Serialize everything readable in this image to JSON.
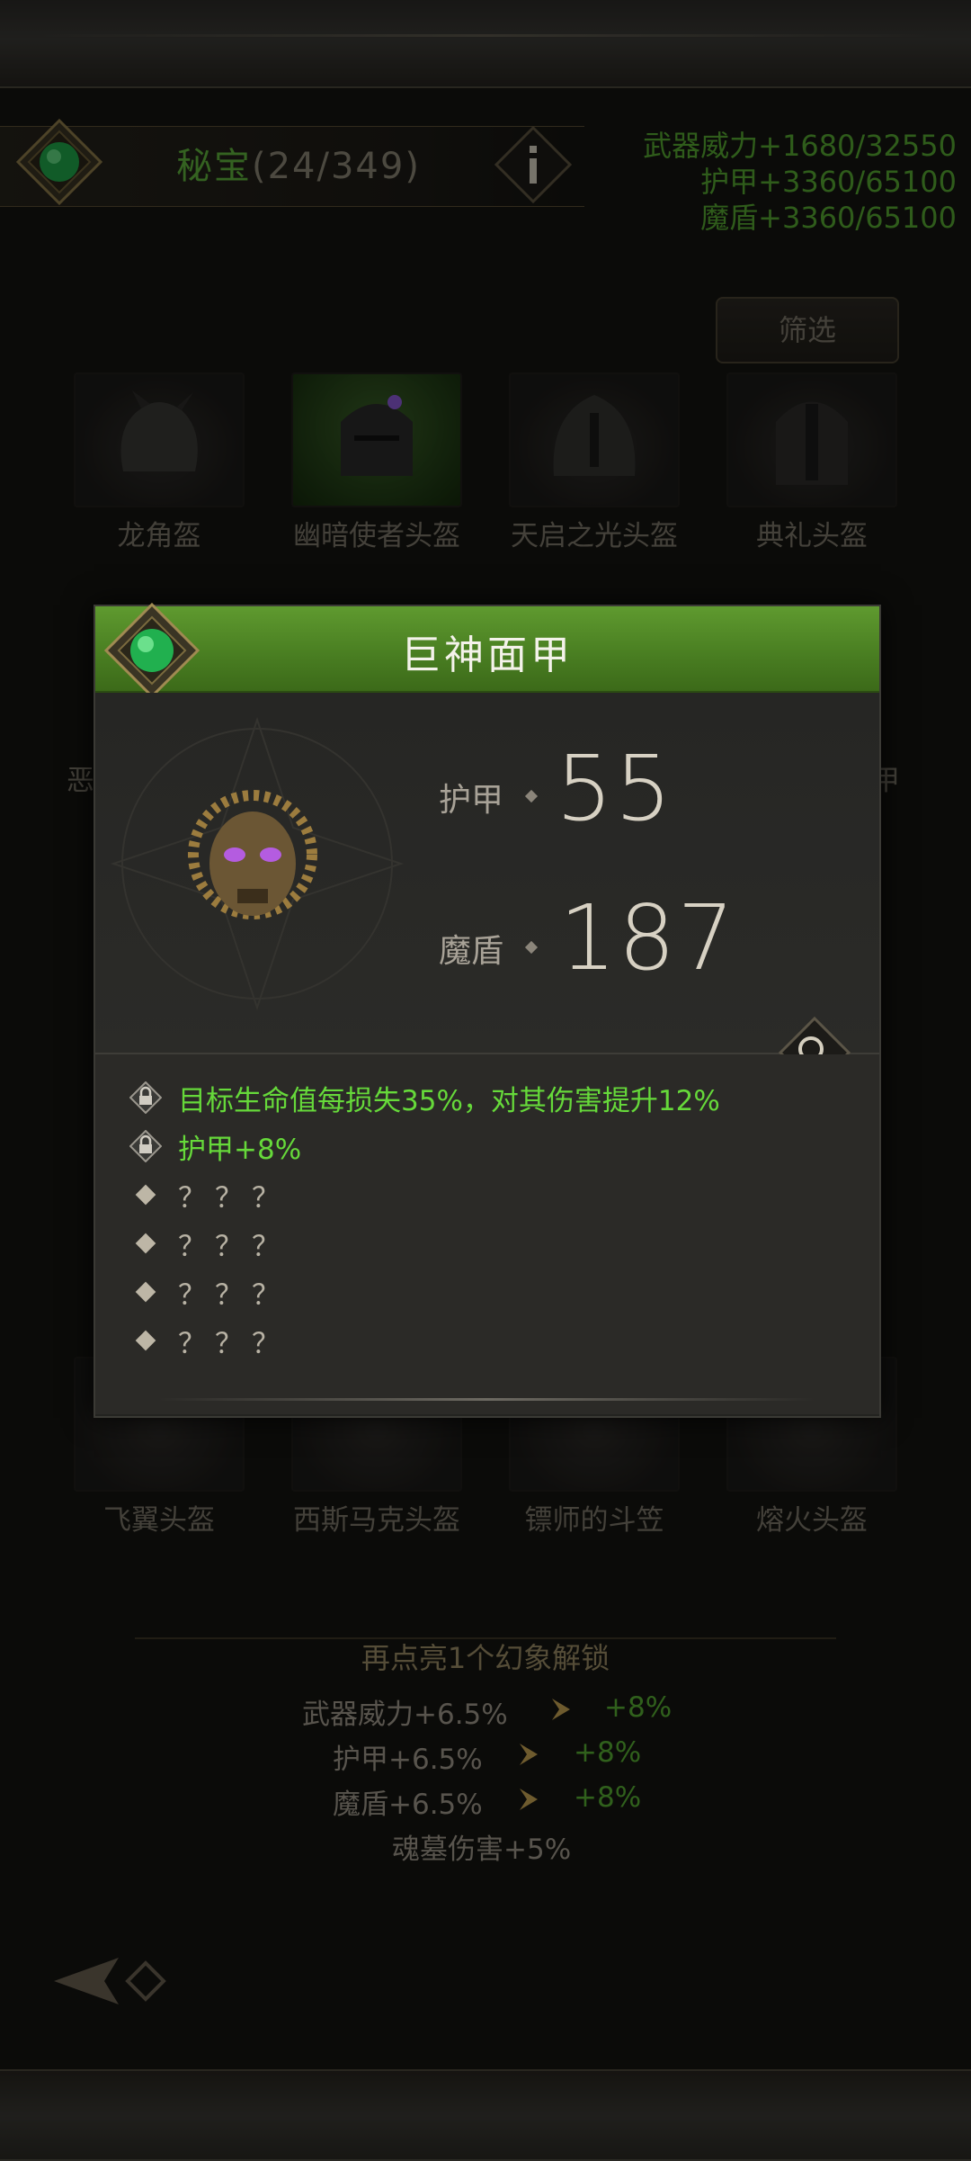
{
  "header": {
    "title": "秘宝",
    "count": "(24/349)",
    "stats": [
      "武器威力+1680/32550",
      "护甲+3360/65100",
      "魔盾+3360/65100"
    ]
  },
  "filter_label": "筛选",
  "grid": {
    "row1": [
      "龙角盔",
      "幽暗使者头盔",
      "天启之光头盔",
      "典礼头盔"
    ],
    "row4": [
      "飞翼头盔",
      "西斯马克头盔",
      "镖师的斗笠",
      "熔火头盔"
    ],
    "partial_left": "恶",
    "partial_right": "甲"
  },
  "popup": {
    "title": "巨神面甲",
    "stat1_label": "护甲",
    "stat1_value": "55",
    "stat2_label": "魔盾",
    "stat2_value": "187",
    "attributes": [
      {
        "text": "目标生命值每损失35%，对其伤害提升12%",
        "type": "locked"
      },
      {
        "text": "护甲+8%",
        "type": "locked"
      },
      {
        "text": "？？？",
        "type": "unknown"
      },
      {
        "text": "？？？",
        "type": "unknown"
      },
      {
        "text": "？？？",
        "type": "unknown"
      },
      {
        "text": "？？？",
        "type": "unknown"
      }
    ]
  },
  "unlock": {
    "heading": "再点亮1个幻象解锁",
    "lines": [
      {
        "label": "武器威力+6.5%",
        "next": "+8%"
      },
      {
        "label": "护甲+6.5%",
        "next": "+8%"
      },
      {
        "label": "魔盾+6.5%",
        "next": "+8%"
      }
    ],
    "extra": "魂墓伤害+5%"
  },
  "colors": {
    "accent_green": "#5fb33c",
    "bright_green": "#66d93a",
    "title_bar_green": "#4a7f22"
  },
  "icons": [
    "gem-emblem-icon",
    "info-icon",
    "lock-icon",
    "diamond-bullet-icon",
    "magnify-icon",
    "arrow-right-icon",
    "back-arrow-icon"
  ]
}
